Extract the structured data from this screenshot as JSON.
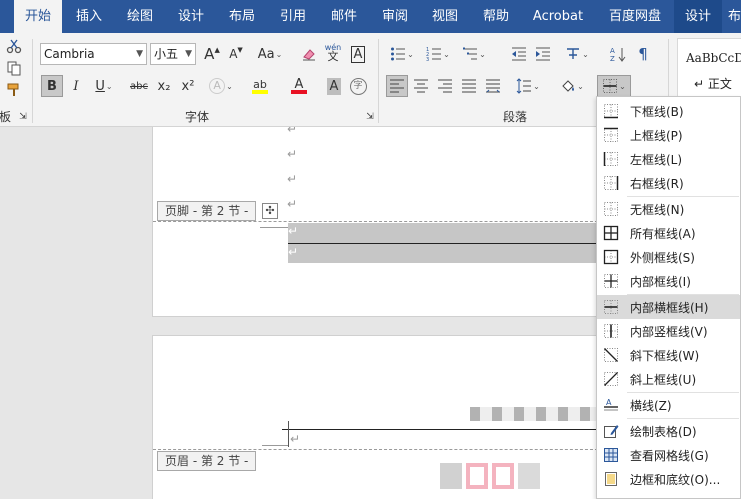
{
  "tabs": [
    {
      "label": "开始",
      "active": true
    },
    {
      "label": "插入"
    },
    {
      "label": "绘图"
    },
    {
      "label": "设计"
    },
    {
      "label": "布局"
    },
    {
      "label": "引用"
    },
    {
      "label": "邮件"
    },
    {
      "label": "审阅"
    },
    {
      "label": "视图"
    },
    {
      "label": "帮助"
    },
    {
      "label": "Acrobat"
    },
    {
      "label": "百度网盘"
    },
    {
      "label": "设计",
      "contextual": true
    },
    {
      "label": "布"
    }
  ],
  "ribbon": {
    "font_name": "Cambria",
    "font_size": "小五",
    "group_font": "字体",
    "group_paragraph": "段落",
    "group_clipboard_partial": "板",
    "styles_sample": "AaBbCcD",
    "styles_name": "↵ 正文",
    "btn_grow": "A",
    "btn_shrink": "A",
    "btn_case": "Aa",
    "btn_phonetic_top": "wén",
    "btn_phonetic_bottom": "文",
    "btn_border_char": "A",
    "btn_bold": "B",
    "btn_italic": "I",
    "btn_underline": "U",
    "btn_strike": "abc",
    "btn_sub": "x₂",
    "btn_sup": "x²",
    "btn_effects": "A",
    "btn_highlight": "ab",
    "btn_font_color": "A",
    "btn_shading": "A",
    "btn_encircle": "字"
  },
  "document": {
    "footer_tag": "页脚 - 第 2 节 -",
    "header_tag": "页眉 - 第 2 节 -",
    "para_mark": "↵",
    "move_handle": "✣"
  },
  "border_menu": {
    "items": [
      {
        "label": "下框线(B)",
        "icon": "border-bottom-icon"
      },
      {
        "label": "上框线(P)",
        "icon": "border-top-icon"
      },
      {
        "label": "左框线(L)",
        "icon": "border-left-icon"
      },
      {
        "label": "右框线(R)",
        "icon": "border-right-icon"
      },
      {
        "label": "无框线(N)",
        "icon": "border-none-icon"
      },
      {
        "label": "所有框线(A)",
        "icon": "border-all-icon"
      },
      {
        "label": "外侧框线(S)",
        "icon": "border-outside-icon"
      },
      {
        "label": "内部框线(I)",
        "icon": "border-inside-icon"
      },
      {
        "label": "内部横框线(H)",
        "icon": "border-inside-horizontal-icon",
        "selected": true
      },
      {
        "label": "内部竖框线(V)",
        "icon": "border-inside-vertical-icon"
      },
      {
        "label": "斜下框线(W)",
        "icon": "diagonal-down-icon"
      },
      {
        "label": "斜上框线(U)",
        "icon": "diagonal-up-icon"
      },
      {
        "label": "横线(Z)",
        "icon": "horizontal-line-icon"
      },
      {
        "label": "绘制表格(D)",
        "icon": "draw-table-icon"
      },
      {
        "label": "查看网格线(G)",
        "icon": "view-gridlines-icon"
      },
      {
        "label": "边框和底纹(O)...",
        "icon": "borders-shading-icon"
      }
    ]
  },
  "colors": {
    "accent": "#2b579a",
    "highlight": "#ffff00",
    "font_color": "#e81123"
  }
}
